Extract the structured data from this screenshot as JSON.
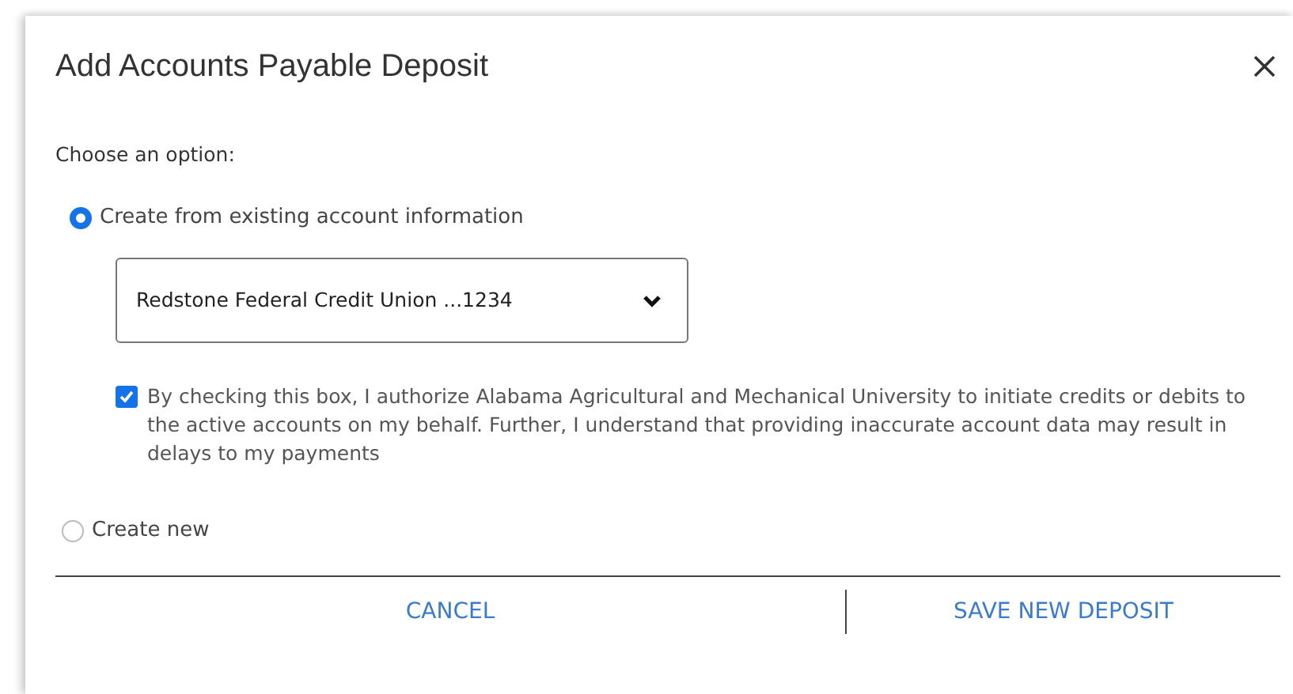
{
  "dialog": {
    "title": "Add Accounts Payable Deposit"
  },
  "prompt": "Choose an option:",
  "options": [
    {
      "label": "Create from existing account information",
      "selected": true
    },
    {
      "label": "Create new",
      "selected": false
    }
  ],
  "account_select": {
    "value": "Redstone Federal Credit Union ...1234"
  },
  "consent": {
    "checked": true,
    "text": "By checking this box, I authorize Alabama Agricultural and Mechanical University to initiate credits or debits to the active accounts on my behalf. Further, I understand that providing inaccurate account data may result in delays to my payments"
  },
  "buttons": [
    "CANCEL",
    "SAVE NEW DEPOSIT"
  ]
}
